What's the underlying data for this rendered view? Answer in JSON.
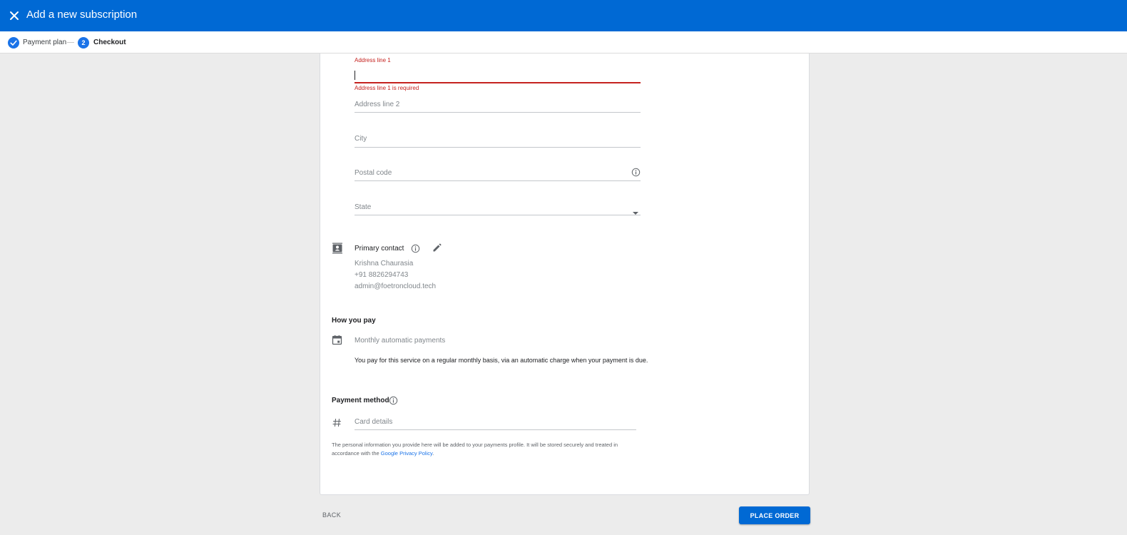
{
  "header": {
    "title": "Add a new subscription",
    "close_icon": "close-icon"
  },
  "stepper": {
    "steps": [
      {
        "label": "Payment plan",
        "status": "complete",
        "icon": "check-icon"
      },
      {
        "number": "2",
        "label": "Checkout",
        "status": "active"
      }
    ]
  },
  "address": {
    "line1": {
      "label": "Address line 1",
      "value": "",
      "error": "Address line 1 is required"
    },
    "line2": {
      "placeholder": "Address line 2"
    },
    "city": {
      "placeholder": "City"
    },
    "postal": {
      "placeholder": "Postal code",
      "icon": "info-icon"
    },
    "state": {
      "placeholder": "State",
      "icon": "dropdown-arrow-icon"
    }
  },
  "contact": {
    "title": "Primary contact",
    "icon": "contact-card-icon",
    "info_icon": "info-icon",
    "edit_icon": "pencil-icon",
    "name": "Krishna Chaurasia",
    "phone": "+91  8826294743",
    "email": "admin@foetroncloud.tech"
  },
  "how_you_pay": {
    "title": "How you pay",
    "icon": "calendar-icon",
    "option": "Monthly automatic payments",
    "description": "You pay for this service on a regular monthly basis, via an automatic charge when your payment is due."
  },
  "payment_method": {
    "title": "Payment method",
    "info_icon": "info-icon",
    "card_icon": "hash-icon",
    "card_placeholder": "Card details"
  },
  "legal": {
    "text_before": "The personal information you provide here will be added to your payments profile. It will be stored securely and treated in accordance with the ",
    "link": "Google Privacy Policy",
    "text_after": "."
  },
  "footer": {
    "back_label": "BACK",
    "place_order_label": "PLACE ORDER"
  },
  "colors": {
    "brand": "#0069d4",
    "error": "#c5221f",
    "link": "#1a73e8"
  }
}
